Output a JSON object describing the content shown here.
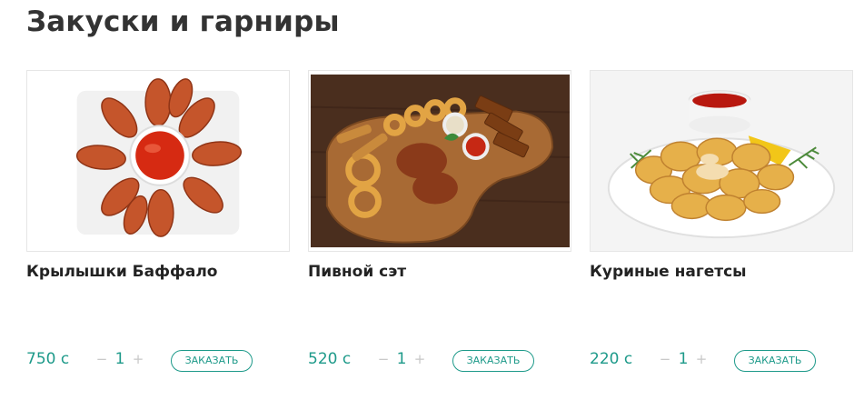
{
  "section": {
    "title": "Закуски и гарниры"
  },
  "products": [
    {
      "name": "Крылышки Баффало",
      "price": "750 с",
      "qty": "1",
      "minus": "−",
      "plus": "+",
      "order_label": "ЗАКАЗАТЬ",
      "image": "buffalo-wings-image"
    },
    {
      "name": "Пивной сэт",
      "price": "520 с",
      "qty": "1",
      "minus": "−",
      "plus": "+",
      "order_label": "ЗАКАЗАТЬ",
      "image": "beer-set-image"
    },
    {
      "name": "Куриные нагетсы",
      "price": "220 с",
      "qty": "1",
      "minus": "−",
      "plus": "+",
      "order_label": "ЗАКАЗАТЬ",
      "image": "chicken-nuggets-image"
    }
  ],
  "colors": {
    "accent": "#1e9a8a",
    "title": "#333333",
    "muted": "#c8c8c8"
  }
}
